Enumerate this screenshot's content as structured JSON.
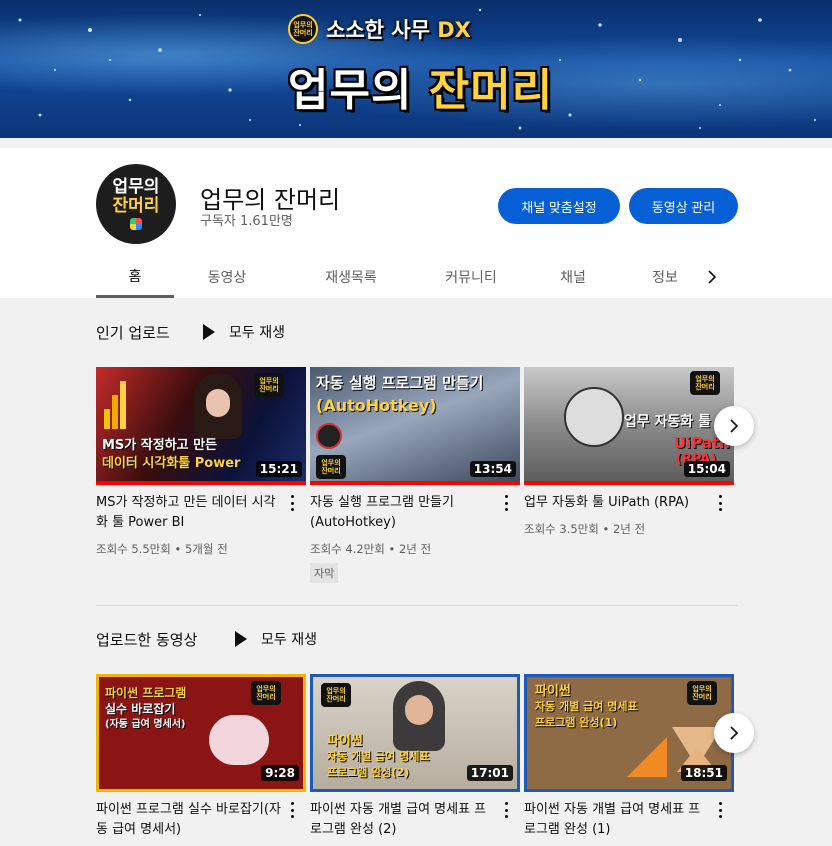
{
  "banner": {
    "subtitle": "소소한 사무",
    "subtitle_suffix": "DX",
    "title_white": "업무의",
    "title_yellow": "잔머리",
    "mini_logo": "업무의\n잔머리"
  },
  "channel": {
    "avatar_line1": "업무의",
    "avatar_line2": "잔머리",
    "name": "업무의 잔머리",
    "subscribers": "구독자 1.61만명",
    "customize_label": "채널 맞춤설정",
    "manage_label": "동영상 관리"
  },
  "tabs": [
    {
      "label": "홈",
      "active": true
    },
    {
      "label": "동영상",
      "active": false
    },
    {
      "label": "재생목록",
      "active": false
    },
    {
      "label": "커뮤니티",
      "active": false
    },
    {
      "label": "채널",
      "active": false
    },
    {
      "label": "정보",
      "active": false
    }
  ],
  "popular": {
    "title": "인기 업로드",
    "play_all": "모두 재생",
    "videos": [
      {
        "title": "MS가 작정하고 만든 데이터 시각화 툴 Power BI",
        "duration": "15:21",
        "meta": "조회수 5.5만회 • 5개월 전",
        "thumb_text1": "MS가 작정하고 만든",
        "thumb_text2": "데이터 시각화툴 Power"
      },
      {
        "title": "자동 실행 프로그램 만들기 (AutoHotkey)",
        "duration": "13:54",
        "meta": "조회수 4.2만회 • 2년 전",
        "badge": "자막",
        "thumb_text1": "자동 실행 프로그램 만들기",
        "thumb_text2": "(AutoHotkey)"
      },
      {
        "title": "업무 자동화 툴 UiPath (RPA)",
        "duration": "15:04",
        "meta": "조회수 3.5만회 • 2년 전",
        "thumb_text1": "업무 자동화 툴",
        "thumb_text2": "UiPath",
        "thumb_text3": "(RPA)"
      }
    ]
  },
  "uploads": {
    "title": "업로드한 동영상",
    "play_all": "모두 재생",
    "videos": [
      {
        "title": "파이썬 프로그램 실수 바로잡기(자동 급여 명세서)",
        "duration": "9:28",
        "thumb_text1": "파이썬 프로그램",
        "thumb_text2": "실수 바로잡기",
        "thumb_text3": "(자동 급여 명세서)"
      },
      {
        "title": "파이썬 자동 개별 급여 명세표 프로그램 완성 (2)",
        "duration": "17:01",
        "thumb_text1": "파이썬",
        "thumb_text2": "자동 개별 급여 명세표",
        "thumb_text3": "프로그램 완성(2)"
      },
      {
        "title": "파이썬 자동 개별 급여 명세표 프로그램 완성 (1)",
        "duration": "18:51",
        "thumb_text1": "파이썬",
        "thumb_text2": "자동 개별 급여 명세표",
        "thumb_text3": "프로그램 완성(1)"
      }
    ]
  },
  "icons": {
    "play": "play-icon",
    "next": "chevron-right-icon",
    "more": "more-vert-icon"
  },
  "colors": {
    "accent": "#065fd4",
    "progress": "#ff0000",
    "brand_yellow": "#ffd23f"
  }
}
